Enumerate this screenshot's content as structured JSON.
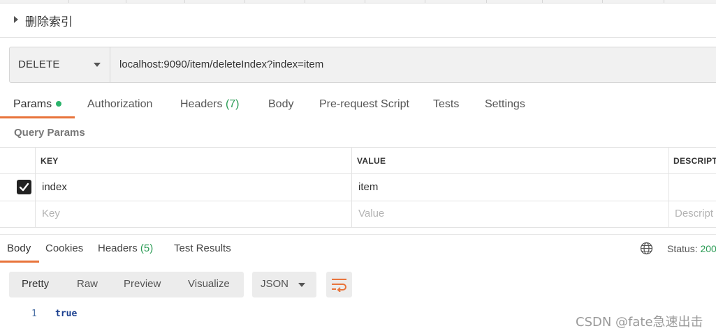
{
  "request": {
    "title": "删除索引",
    "method": "DELETE",
    "url": "localhost:9090/item/deleteIndex?index=item"
  },
  "request_tabs": [
    {
      "label": "Params",
      "active": true,
      "dot": true
    },
    {
      "label": "Authorization"
    },
    {
      "label": "Headers",
      "count": "(7)"
    },
    {
      "label": "Body"
    },
    {
      "label": "Pre-request Script"
    },
    {
      "label": "Tests"
    },
    {
      "label": "Settings"
    }
  ],
  "query_params": {
    "label": "Query Params",
    "columns": [
      "KEY",
      "VALUE",
      "DESCRIPTI"
    ],
    "rows": [
      {
        "checked": true,
        "key": "index",
        "value": "item",
        "description": ""
      }
    ],
    "placeholders": {
      "key": "Key",
      "value": "Value",
      "description": "Descript"
    }
  },
  "response_tabs": [
    {
      "label": "Body",
      "active": true
    },
    {
      "label": "Cookies"
    },
    {
      "label": "Headers",
      "count": "(5)"
    },
    {
      "label": "Test Results"
    }
  ],
  "status": {
    "label": "Status:",
    "value": "200"
  },
  "view_modes": [
    "Pretty",
    "Raw",
    "Preview",
    "Visualize"
  ],
  "format": "JSON",
  "body_lines": [
    {
      "n": "1",
      "text": "true"
    }
  ],
  "watermark": "CSDN @fate急速出击",
  "icons": {
    "expand": "caret-right-icon",
    "method_dropdown": "chevron-down-icon",
    "checkbox": "check-icon",
    "globe": "globe-icon",
    "wrap": "wrap-lines-icon"
  },
  "colors": {
    "accent": "#e8743b",
    "success": "#2b9c55"
  }
}
